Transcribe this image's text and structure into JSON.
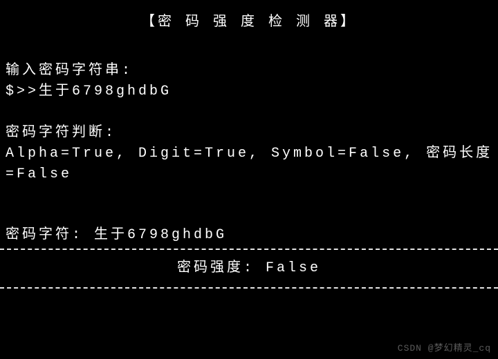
{
  "header": {
    "title": "【密 码 强 度 检 测 器】"
  },
  "input_section": {
    "label": "输入密码字符串:",
    "prompt": "$>>生于6798ghdbG"
  },
  "check_section": {
    "label": "密码字符判断:",
    "result": "Alpha=True, Digit=True, Symbol=False, 密码长度=False"
  },
  "echo_section": {
    "text": "密码字符: 生于6798ghdbG"
  },
  "strength_section": {
    "text": "密码强度: False"
  },
  "watermark": "CSDN @梦幻精灵_cq"
}
